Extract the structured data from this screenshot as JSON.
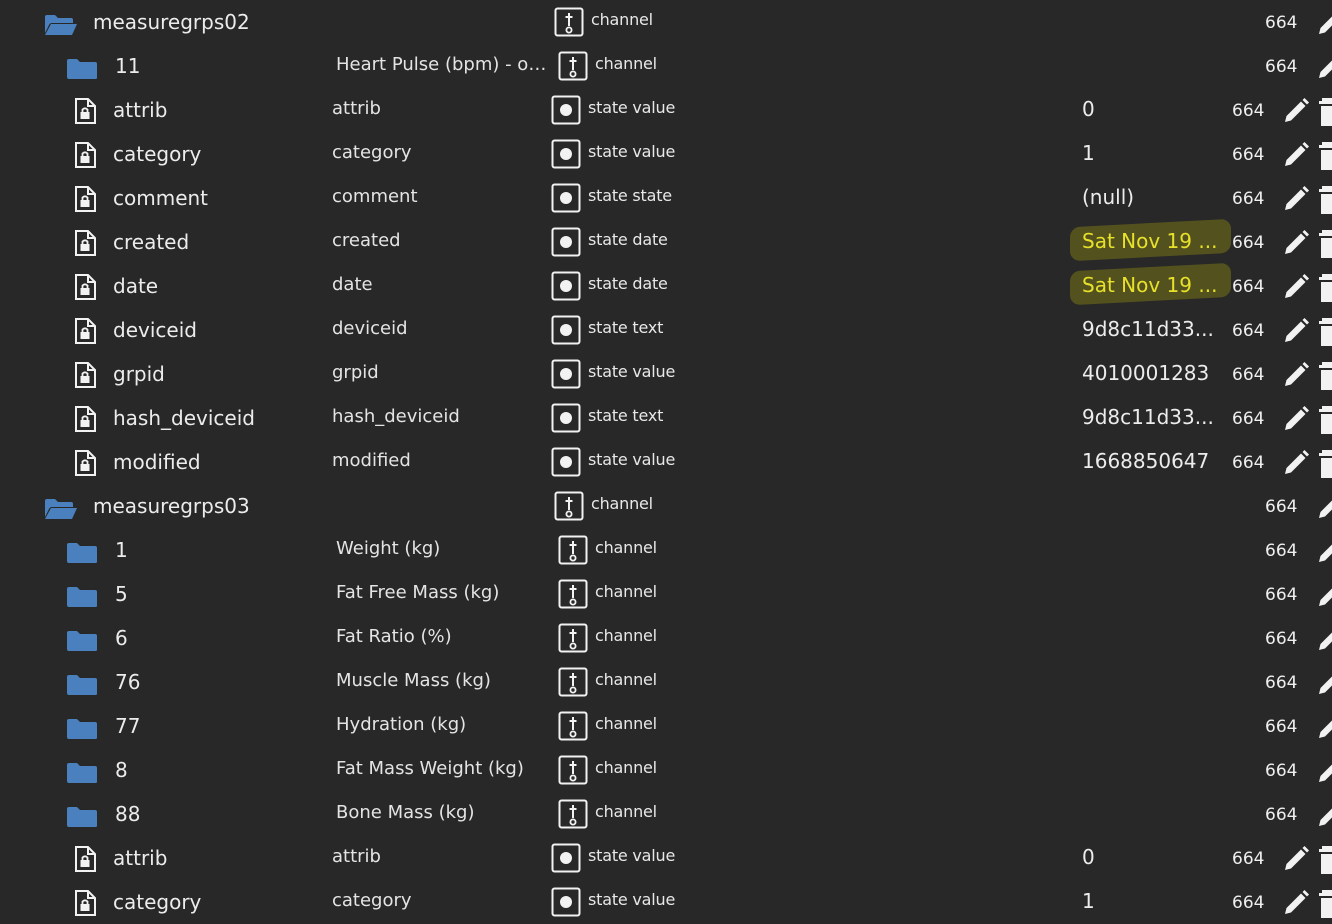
{
  "rows": [
    {
      "kind": "folder",
      "level": 0,
      "icon": "folder-open-icon",
      "name": "measuregrps02",
      "desc": "",
      "type": "channel",
      "type_icon": "channel-icon",
      "value": "",
      "perm": "664"
    },
    {
      "kind": "folder",
      "level": 1,
      "icon": "folder-icon",
      "name": "11",
      "desc": "Heart Pulse (bpm) - onl...",
      "type": "channel",
      "type_icon": "channel-icon",
      "value": "",
      "perm": "664"
    },
    {
      "kind": "state",
      "level": 1,
      "icon": "file-lock-icon",
      "name": "attrib",
      "desc": "attrib",
      "type": "state value",
      "type_icon": "state-icon",
      "value": "0",
      "perm": "664"
    },
    {
      "kind": "state",
      "level": 1,
      "icon": "file-lock-icon",
      "name": "category",
      "desc": "category",
      "type": "state value",
      "type_icon": "state-icon",
      "value": "1",
      "perm": "664"
    },
    {
      "kind": "state",
      "level": 1,
      "icon": "file-lock-icon",
      "name": "comment",
      "desc": "comment",
      "type": "state state",
      "type_icon": "state-icon",
      "value": "(null)",
      "perm": "664"
    },
    {
      "kind": "state",
      "level": 1,
      "icon": "file-lock-icon",
      "name": "created",
      "desc": "created",
      "type": "state date",
      "type_icon": "state-icon",
      "value": "Sat Nov 19 ...",
      "highlight": true,
      "perm": "664"
    },
    {
      "kind": "state",
      "level": 1,
      "icon": "file-lock-icon",
      "name": "date",
      "desc": "date",
      "type": "state date",
      "type_icon": "state-icon",
      "value": "Sat Nov 19 ...",
      "highlight": true,
      "perm": "664"
    },
    {
      "kind": "state",
      "level": 1,
      "icon": "file-lock-icon",
      "name": "deviceid",
      "desc": "deviceid",
      "type": "state text",
      "type_icon": "state-icon",
      "value": "9d8c11d33...",
      "perm": "664"
    },
    {
      "kind": "state",
      "level": 1,
      "icon": "file-lock-icon",
      "name": "grpid",
      "desc": "grpid",
      "type": "state value",
      "type_icon": "state-icon",
      "value": "4010001283",
      "perm": "664"
    },
    {
      "kind": "state",
      "level": 1,
      "icon": "file-lock-icon",
      "name": "hash_deviceid",
      "desc": "hash_deviceid",
      "type": "state text",
      "type_icon": "state-icon",
      "value": "9d8c11d33...",
      "perm": "664"
    },
    {
      "kind": "state",
      "level": 1,
      "icon": "file-lock-icon",
      "name": "modified",
      "desc": "modified",
      "type": "state value",
      "type_icon": "state-icon",
      "value": "1668850647",
      "perm": "664"
    },
    {
      "kind": "folder",
      "level": 0,
      "icon": "folder-open-icon",
      "name": "measuregrps03",
      "desc": "",
      "type": "channel",
      "type_icon": "channel-icon",
      "value": "",
      "perm": "664"
    },
    {
      "kind": "folder",
      "level": 1,
      "icon": "folder-icon",
      "name": "1",
      "desc": "Weight (kg)",
      "type": "channel",
      "type_icon": "channel-icon",
      "value": "",
      "perm": "664"
    },
    {
      "kind": "folder",
      "level": 1,
      "icon": "folder-icon",
      "name": "5",
      "desc": "Fat Free Mass (kg)",
      "type": "channel",
      "type_icon": "channel-icon",
      "value": "",
      "perm": "664"
    },
    {
      "kind": "folder",
      "level": 1,
      "icon": "folder-icon",
      "name": "6",
      "desc": "Fat Ratio (%)",
      "type": "channel",
      "type_icon": "channel-icon",
      "value": "",
      "perm": "664"
    },
    {
      "kind": "folder",
      "level": 1,
      "icon": "folder-icon",
      "name": "76",
      "desc": "Muscle Mass (kg)",
      "type": "channel",
      "type_icon": "channel-icon",
      "value": "",
      "perm": "664"
    },
    {
      "kind": "folder",
      "level": 1,
      "icon": "folder-icon",
      "name": "77",
      "desc": "Hydration (kg)",
      "type": "channel",
      "type_icon": "channel-icon",
      "value": "",
      "perm": "664"
    },
    {
      "kind": "folder",
      "level": 1,
      "icon": "folder-icon",
      "name": "8",
      "desc": "Fat Mass Weight (kg)",
      "type": "channel",
      "type_icon": "channel-icon",
      "value": "",
      "perm": "664"
    },
    {
      "kind": "folder",
      "level": 1,
      "icon": "folder-icon",
      "name": "88",
      "desc": "Bone Mass (kg)",
      "type": "channel",
      "type_icon": "channel-icon",
      "value": "",
      "perm": "664"
    },
    {
      "kind": "state",
      "level": 1,
      "icon": "file-lock-icon",
      "name": "attrib",
      "desc": "attrib",
      "type": "state value",
      "type_icon": "state-icon",
      "value": "0",
      "perm": "664"
    },
    {
      "kind": "state",
      "level": 1,
      "icon": "file-lock-icon",
      "name": "category",
      "desc": "category",
      "type": "state value",
      "type_icon": "state-icon",
      "value": "1",
      "perm": "664"
    }
  ],
  "colors": {
    "folder": "#4a80be",
    "icon_white": "#f2f2f2",
    "highlight_text": "#e8e12a",
    "background": "#282828"
  }
}
